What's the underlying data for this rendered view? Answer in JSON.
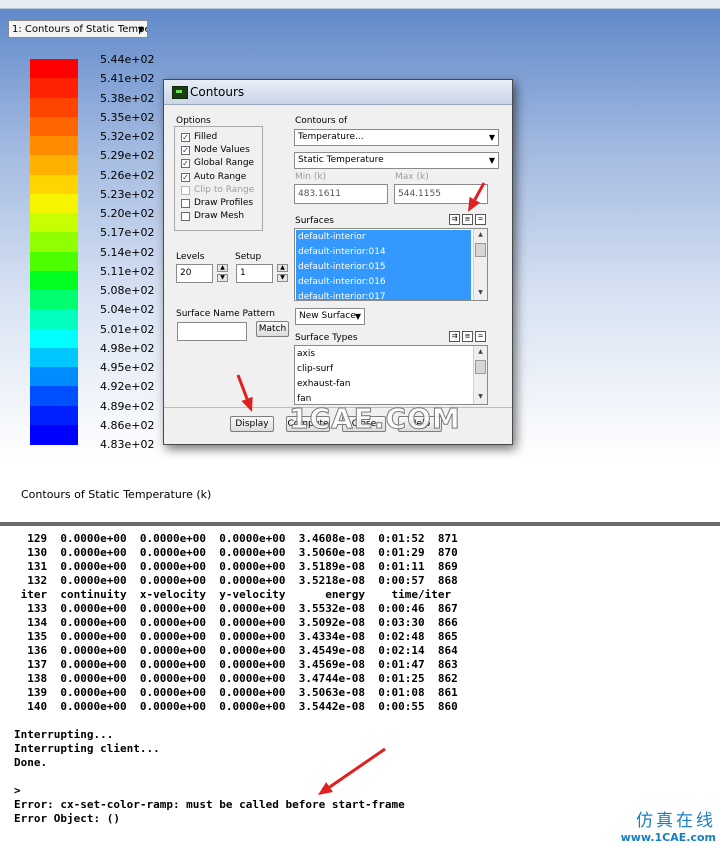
{
  "graphics": {
    "view_select": "1: Contours of Static Temper",
    "colorbar": {
      "labels": [
        "5.44e+02",
        "5.41e+02",
        "5.38e+02",
        "5.35e+02",
        "5.32e+02",
        "5.29e+02",
        "5.26e+02",
        "5.23e+02",
        "5.20e+02",
        "5.17e+02",
        "5.14e+02",
        "5.11e+02",
        "5.08e+02",
        "5.04e+02",
        "5.01e+02",
        "4.98e+02",
        "4.95e+02",
        "4.92e+02",
        "4.89e+02",
        "4.86e+02",
        "4.83e+02"
      ],
      "colors": [
        "#ff0000",
        "#ff2200",
        "#ff4400",
        "#ff6600",
        "#ff8c00",
        "#ffb000",
        "#ffd400",
        "#f5f500",
        "#c8ff00",
        "#90ff00",
        "#4cff00",
        "#00ff20",
        "#00ff70",
        "#00ffbc",
        "#00ffff",
        "#00c8ff",
        "#008cff",
        "#0050ff",
        "#0020ff",
        "#0000ff"
      ]
    },
    "title": "Contours of Static Temperature (k)"
  },
  "dialog": {
    "title": "Contours",
    "options_label": "Options",
    "options": [
      {
        "label": "Filled",
        "checked": true,
        "enabled": true
      },
      {
        "label": "Node Values",
        "checked": true,
        "enabled": true
      },
      {
        "label": "Global Range",
        "checked": true,
        "enabled": true
      },
      {
        "label": "Auto Range",
        "checked": true,
        "enabled": true
      },
      {
        "label": "Clip to Range",
        "checked": false,
        "enabled": false
      },
      {
        "label": "Draw Profiles",
        "checked": false,
        "enabled": true
      },
      {
        "label": "Draw Mesh",
        "checked": false,
        "enabled": true
      }
    ],
    "levels_label": "Levels",
    "levels_value": "20",
    "setup_label": "Setup",
    "setup_value": "1",
    "surface_name_pattern_label": "Surface Name Pattern",
    "surface_name_pattern_value": "",
    "match_button": "Match",
    "contours_of_label": "Contours of",
    "contours_of_value": "Temperature...",
    "contours_of_sub_value": "Static Temperature",
    "min_label": "Min (k)",
    "min_value": "483.1611",
    "max_label": "Max (k)",
    "max_value": "544.1155",
    "surfaces_label": "Surfaces",
    "surfaces": [
      "default-interior",
      "default-interior:014",
      "default-interior:015",
      "default-interior:016",
      "default-interior:017"
    ],
    "new_surface_button": "New Surface",
    "surface_types_label": "Surface Types",
    "surface_types": [
      "axis",
      "clip-surf",
      "exhaust-fan",
      "fan"
    ],
    "buttons": {
      "display": "Display",
      "compute": "Compute",
      "close": "Close",
      "help": "Help"
    }
  },
  "console": {
    "lines": [
      "  129  0.0000e+00  0.0000e+00  0.0000e+00  3.4608e-08  0:01:52  871",
      "  130  0.0000e+00  0.0000e+00  0.0000e+00  3.5060e-08  0:01:29  870",
      "  131  0.0000e+00  0.0000e+00  0.0000e+00  3.5189e-08  0:01:11  869",
      "  132  0.0000e+00  0.0000e+00  0.0000e+00  3.5218e-08  0:00:57  868",
      " iter  continuity  x-velocity  y-velocity      energy    time/iter",
      "  133  0.0000e+00  0.0000e+00  0.0000e+00  3.5532e-08  0:00:46  867",
      "  134  0.0000e+00  0.0000e+00  0.0000e+00  3.5092e-08  0:03:30  866",
      "  135  0.0000e+00  0.0000e+00  0.0000e+00  3.4334e-08  0:02:48  865",
      "  136  0.0000e+00  0.0000e+00  0.0000e+00  3.4549e-08  0:02:14  864",
      "  137  0.0000e+00  0.0000e+00  0.0000e+00  3.4569e-08  0:01:47  863",
      "  138  0.0000e+00  0.0000e+00  0.0000e+00  3.4744e-08  0:01:25  862",
      "  139  0.0000e+00  0.0000e+00  0.0000e+00  3.5063e-08  0:01:08  861",
      "  140  0.0000e+00  0.0000e+00  0.0000e+00  3.5442e-08  0:00:55  860",
      "",
      "Interrupting...",
      "Interrupting client...",
      "Done.",
      "",
      ">",
      "Error: cx-set-color-ramp: must be called before start-frame",
      "Error Object: ()"
    ]
  },
  "watermark": "1CAE.COM",
  "brand": {
    "cn": "仿真在线",
    "url": "www.1CAE.com"
  },
  "annotation_color": "#e02020"
}
